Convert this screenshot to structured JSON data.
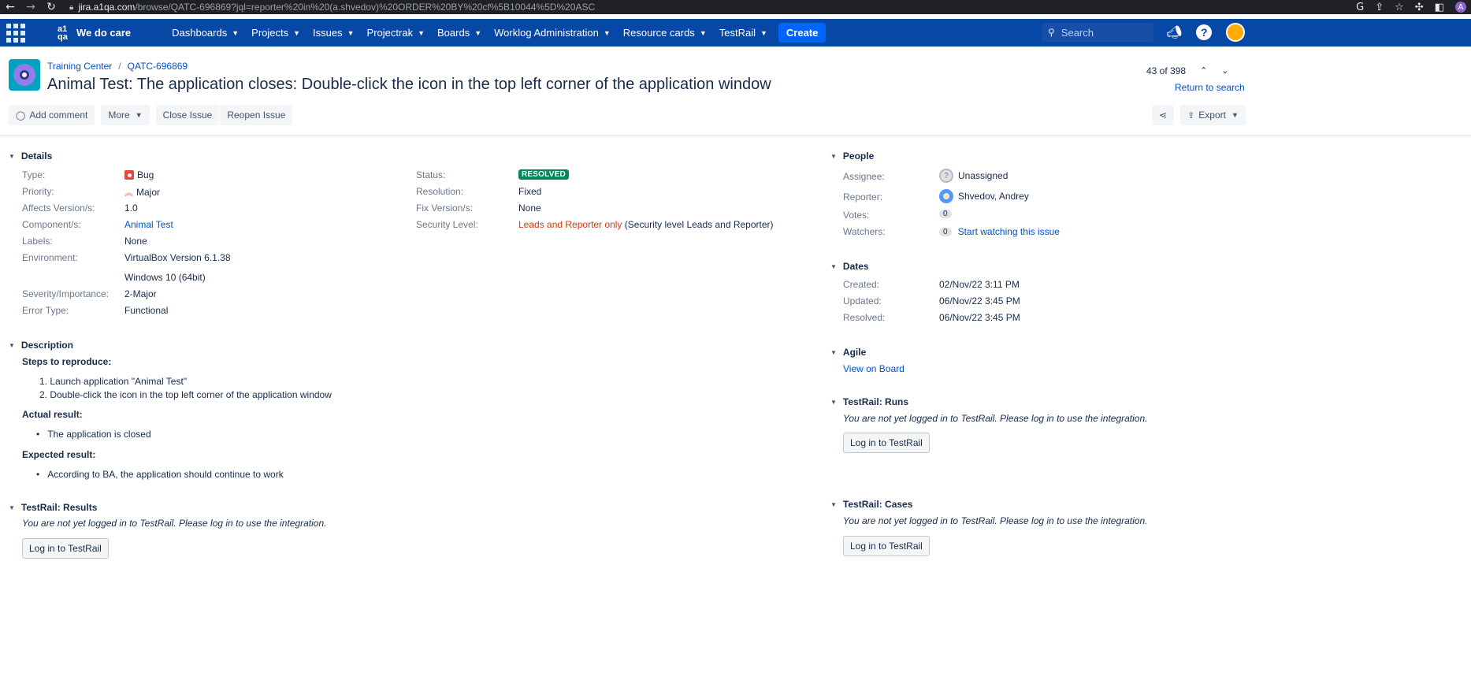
{
  "browser": {
    "url_host": "jira.a1qa.com",
    "url_path": "/browse/QATC-696869?jql=reporter%20in%20(a.shvedov)%20ORDER%20BY%20cf%5B10044%5D%20ASC",
    "profile_initial": "A"
  },
  "topnav": {
    "brand_logo": "a1\nqa",
    "brand_text": "We do care",
    "menu": [
      "Dashboards",
      "Projects",
      "Issues",
      "Projectrak",
      "Boards",
      "Worklog Administration",
      "Resource cards",
      "TestRail"
    ],
    "create_label": "Create",
    "search_placeholder": "Search"
  },
  "header": {
    "project": "Training Center",
    "issue_key": "QATC-696869",
    "title": "Animal Test: The application closes: Double-click the icon in the top left corner of the application window",
    "pager": "43 of 398",
    "return_link": "Return to search"
  },
  "toolbar": {
    "add_comment": "Add comment",
    "more": "More",
    "close_issue": "Close Issue",
    "reopen_issue": "Reopen Issue",
    "export": "Export"
  },
  "details": {
    "heading": "Details",
    "type_label": "Type:",
    "type_value": "Bug",
    "priority_label": "Priority:",
    "priority_value": "Major",
    "affects_label": "Affects Version/s:",
    "affects_value": "1.0",
    "component_label": "Component/s:",
    "component_value": "Animal Test",
    "labels_label": "Labels:",
    "labels_value": "None",
    "environment_label": "Environment:",
    "environment_line1": "VirtualBox Version 6.1.38",
    "environment_line2": "Windows 10 (64bit)",
    "severity_label": "Severity/Importance:",
    "severity_value": "2-Major",
    "error_label": "Error Type:",
    "error_value": "Functional",
    "status_label": "Status:",
    "status_value": "RESOLVED",
    "resolution_label": "Resolution:",
    "resolution_value": "Fixed",
    "fix_label": "Fix Version/s:",
    "fix_value": "None",
    "security_label": "Security Level:",
    "security_value": "Leads and Reporter only",
    "security_note": "(Security level Leads and Reporter)"
  },
  "description": {
    "heading": "Description",
    "steps_title": "Steps to reproduce:",
    "steps": [
      "1. Launch application \"Animal Test\"",
      "2. Double-click the icon in the top left corner of the application window"
    ],
    "actual_title": "Actual result:",
    "actual": "The application is closed",
    "expected_title": "Expected result:",
    "expected": "According to BA, the application should continue to work"
  },
  "testrail_results": {
    "heading": "TestRail: Results",
    "note": "You are not yet logged in to TestRail. Please log in to use the integration.",
    "button": "Log in to TestRail"
  },
  "people": {
    "heading": "People",
    "assignee_label": "Assignee:",
    "assignee_value": "Unassigned",
    "reporter_label": "Reporter:",
    "reporter_value": "Shvedov, Andrey",
    "votes_label": "Votes:",
    "votes_value": "0",
    "watchers_label": "Watchers:",
    "watchers_value": "0",
    "watch_link": "Start watching this issue"
  },
  "dates": {
    "heading": "Dates",
    "created_label": "Created:",
    "created_value": "02/Nov/22 3:11 PM",
    "updated_label": "Updated:",
    "updated_value": "06/Nov/22 3:45 PM",
    "resolved_label": "Resolved:",
    "resolved_value": "06/Nov/22 3:45 PM"
  },
  "agile": {
    "heading": "Agile",
    "link": "View on Board"
  },
  "testrail_runs": {
    "heading": "TestRail: Runs",
    "note": "You are not yet logged in to TestRail. Please log in to use the integration.",
    "button": "Log in to TestRail"
  },
  "testrail_cases": {
    "heading": "TestRail: Cases",
    "note": "You are not yet logged in to TestRail. Please log in to use the integration.",
    "button": "Log in to TestRail"
  }
}
